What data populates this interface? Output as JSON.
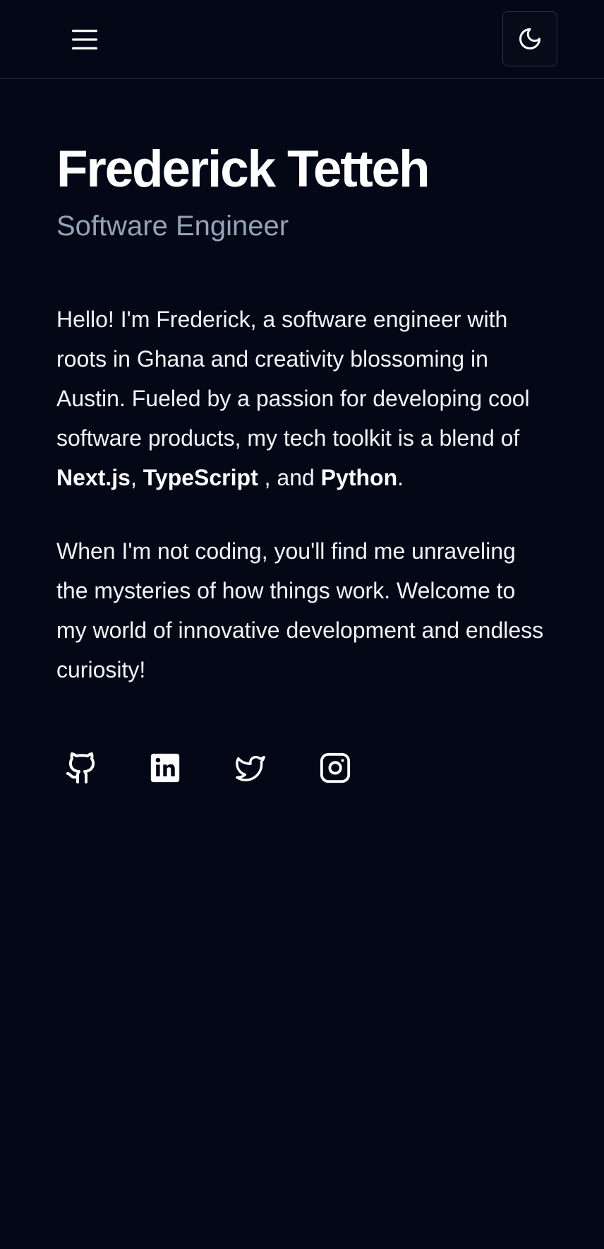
{
  "header": {
    "menu_icon": "hamburger-menu-icon",
    "theme_icon": "moon-icon"
  },
  "profile": {
    "name": "Frederick Tetteh",
    "role": "Software Engineer"
  },
  "bio": {
    "p1_start": "Hello! I'm Frederick, a software engineer with roots in Ghana and creativity blossoming in Austin. Fueled by a passion for developing cool software products, my tech toolkit is a blend of ",
    "skill_1": "Next.js",
    "sep_1": ", ",
    "skill_2": "TypeScript",
    "sep_2": " , and ",
    "skill_3": "Python",
    "p1_end": ".",
    "p2": "When I'm not coding, you'll find me unraveling the mysteries of how things work. Welcome to my world of innovative development and endless curiosity!"
  },
  "socials": [
    {
      "icon": "github-icon"
    },
    {
      "icon": "linkedin-icon"
    },
    {
      "icon": "twitter-icon"
    },
    {
      "icon": "instagram-icon"
    }
  ],
  "colors": {
    "background": "#040816",
    "text": "#f8fafc",
    "muted": "#94a3b8",
    "border": "#1e293b"
  }
}
